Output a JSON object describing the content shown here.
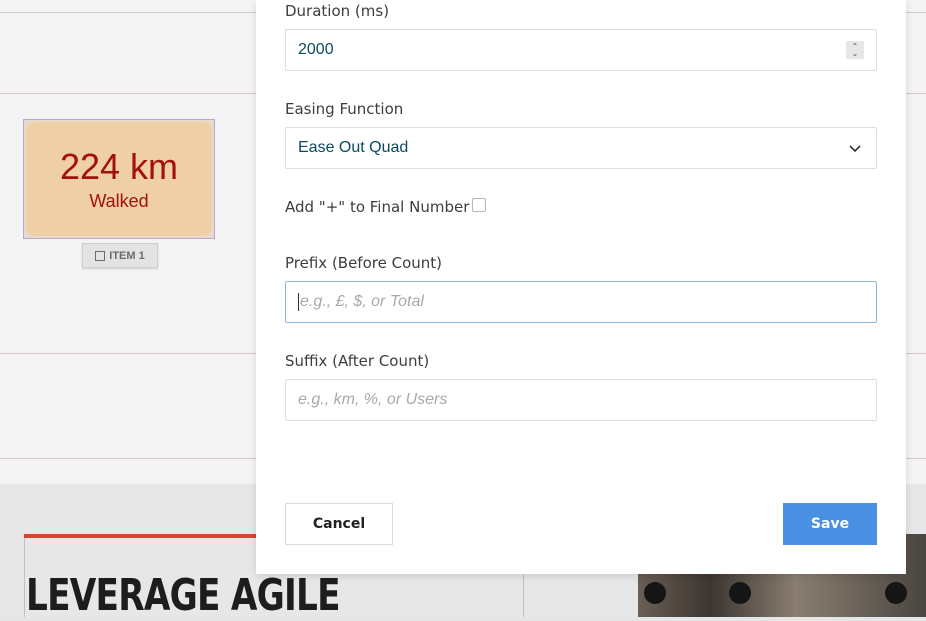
{
  "background": {
    "counter": {
      "number": "224 km",
      "label": "Walked"
    },
    "item_tab": {
      "label": "ITEM 1"
    },
    "hero_title": "LEVERAGE AGILE"
  },
  "modal": {
    "duration": {
      "label": "Duration (ms)",
      "value": "2000"
    },
    "easing": {
      "label": "Easing Function",
      "selected": "Ease Out Quad"
    },
    "plus_option": {
      "label": "Add \"+\" to Final Number",
      "checked": false
    },
    "prefix": {
      "label": "Prefix (Before Count)",
      "placeholder": "e.g., £, $, or Total",
      "value": ""
    },
    "suffix": {
      "label": "Suffix (After Count)",
      "placeholder": "e.g., km, %, or Users",
      "value": ""
    },
    "buttons": {
      "cancel": "Cancel",
      "save": "Save"
    }
  },
  "colors": {
    "accent": "#4a90e2",
    "counter_text": "#a41010",
    "counter_bg": "#efcfa6",
    "hero_bar": "#d9442f"
  },
  "icons": {
    "spinner": "up-down-stepper-icon",
    "select": "chevron-down-icon",
    "item_tab": "square-icon"
  }
}
